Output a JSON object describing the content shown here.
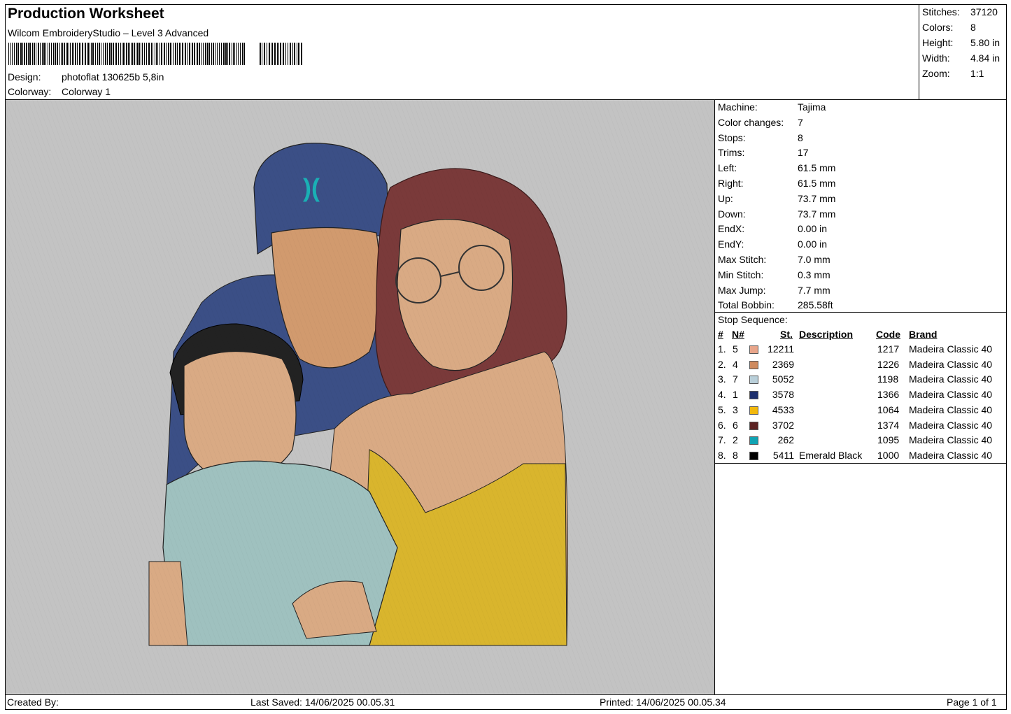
{
  "header": {
    "title": "Production Worksheet",
    "software": "Wilcom EmbroideryStudio – Level 3 Advanced",
    "design_label": "Design:",
    "design_value": "photoflat 130625b 5,8in",
    "colorway_label": "Colorway:",
    "colorway_value": "Colorway 1"
  },
  "stats": [
    {
      "label": "Stitches:",
      "value": "37120"
    },
    {
      "label": "Colors:",
      "value": "8"
    },
    {
      "label": "Height:",
      "value": "5.80 in"
    },
    {
      "label": "Width:",
      "value": "4.84 in"
    },
    {
      "label": "Zoom:",
      "value": "1:1"
    }
  ],
  "machine_info": [
    {
      "label": "Machine:",
      "value": "Tajima"
    },
    {
      "label": "Color changes:",
      "value": "7"
    },
    {
      "label": "Stops:",
      "value": "8"
    },
    {
      "label": "Trims:",
      "value": "17"
    },
    {
      "label": "Left:",
      "value": "61.5 mm"
    },
    {
      "label": "Right:",
      "value": "61.5 mm"
    },
    {
      "label": "Up:",
      "value": "73.7 mm"
    },
    {
      "label": "Down:",
      "value": "73.7 mm"
    },
    {
      "label": "EndX:",
      "value": "0.00 in"
    },
    {
      "label": "EndY:",
      "value": "0.00 in"
    },
    {
      "label": "Max Stitch:",
      "value": "7.0 mm"
    },
    {
      "label": "Min Stitch:",
      "value": "0.3 mm"
    },
    {
      "label": "Max Jump:",
      "value": "7.7 mm"
    },
    {
      "label": "Total Bobbin:",
      "value": "285.58ft"
    }
  ],
  "stop_sequence": {
    "title": "Stop Sequence:",
    "columns": [
      "#",
      "N#",
      "St.",
      "Description",
      "Code",
      "Brand"
    ],
    "rows": [
      {
        "idx": "1.",
        "n": "5",
        "color": "#e8a58a",
        "st": "12211",
        "desc": "",
        "code": "1217",
        "brand": "Madeira Classic 40"
      },
      {
        "idx": "2.",
        "n": "4",
        "color": "#cf8a5e",
        "st": "2369",
        "desc": "",
        "code": "1226",
        "brand": "Madeira Classic 40"
      },
      {
        "idx": "3.",
        "n": "7",
        "color": "#b9cfd9",
        "st": "5052",
        "desc": "",
        "code": "1198",
        "brand": "Madeira Classic 40"
      },
      {
        "idx": "4.",
        "n": "1",
        "color": "#1d2f6e",
        "st": "3578",
        "desc": "",
        "code": "1366",
        "brand": "Madeira Classic 40"
      },
      {
        "idx": "5.",
        "n": "3",
        "color": "#f2b80c",
        "st": "4533",
        "desc": "",
        "code": "1064",
        "brand": "Madeira Classic 40"
      },
      {
        "idx": "6.",
        "n": "6",
        "color": "#5c2323",
        "st": "3702",
        "desc": "",
        "code": "1374",
        "brand": "Madeira Classic 40"
      },
      {
        "idx": "7.",
        "n": "2",
        "color": "#10a3b3",
        "st": "262",
        "desc": "",
        "code": "1095",
        "brand": "Madeira Classic 40"
      },
      {
        "idx": "8.",
        "n": "8",
        "color": "#000000",
        "st": "5411",
        "desc": "Emerald Black",
        "code": "1000",
        "brand": "Madeira Classic 40"
      }
    ]
  },
  "footer": {
    "created_by": "Created By:",
    "last_saved": "Last Saved: 14/06/2025 00.05.31",
    "printed": "Printed: 14/06/2025 00.05.34",
    "page": "Page 1 of 1"
  },
  "colors": {
    "canvas_bg": "#c3c3c3",
    "skin": "#d9aa84",
    "cap": "#3b4f86",
    "shirt": "#9fc1bf",
    "dress": "#d9b52d",
    "hair": "#6b3232",
    "logo": "#1ab0b5"
  }
}
